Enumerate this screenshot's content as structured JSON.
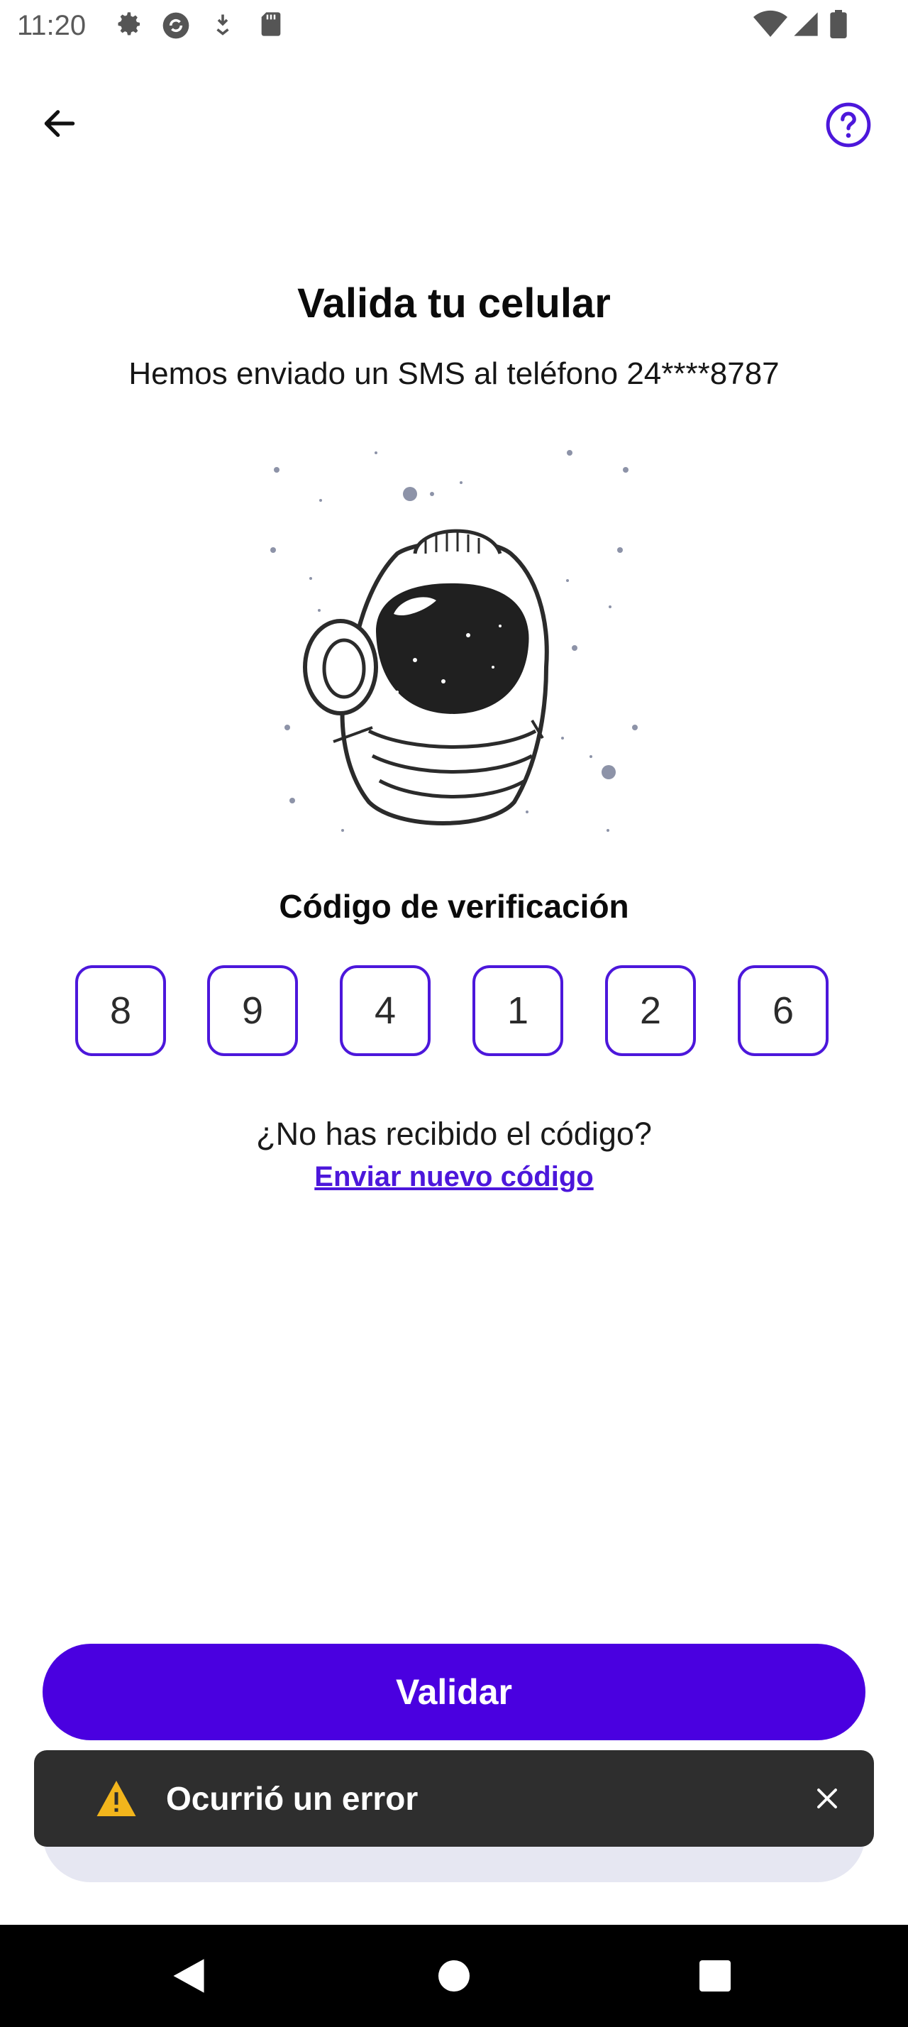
{
  "status_bar": {
    "time": "11:20",
    "left_icons": [
      "settings-gear-icon",
      "sync-app-icon",
      "download-arrow-icon",
      "sd-card-icon"
    ],
    "right_icons": [
      "wifi-icon",
      "cell-signal-icon",
      "battery-icon"
    ]
  },
  "app_bar": {
    "back_icon": "arrow-left-icon",
    "help_icon": "help-circle-icon",
    "accent": "#4c17db"
  },
  "header": {
    "title": "Valida tu celular",
    "subtitle": "Hemos enviado un SMS al teléfono 24****8787"
  },
  "illustration": {
    "icon": "astronaut-helmet-illustration"
  },
  "verification": {
    "label": "Código de verificación",
    "digits": [
      "8",
      "9",
      "4",
      "1",
      "2",
      "6"
    ]
  },
  "resend": {
    "question": "¿No has recibido el código?",
    "link": "Enviar nuevo código"
  },
  "primary_button": {
    "label": "Validar",
    "color": "#4a00e0"
  },
  "toast": {
    "icon": "warning-triangle-icon",
    "message": "Ocurrió un error",
    "close_icon": "close-icon",
    "background": "#2e2e2e"
  },
  "nav_bar": {
    "icons": [
      "nav-back-icon",
      "nav-home-icon",
      "nav-recents-icon"
    ]
  }
}
